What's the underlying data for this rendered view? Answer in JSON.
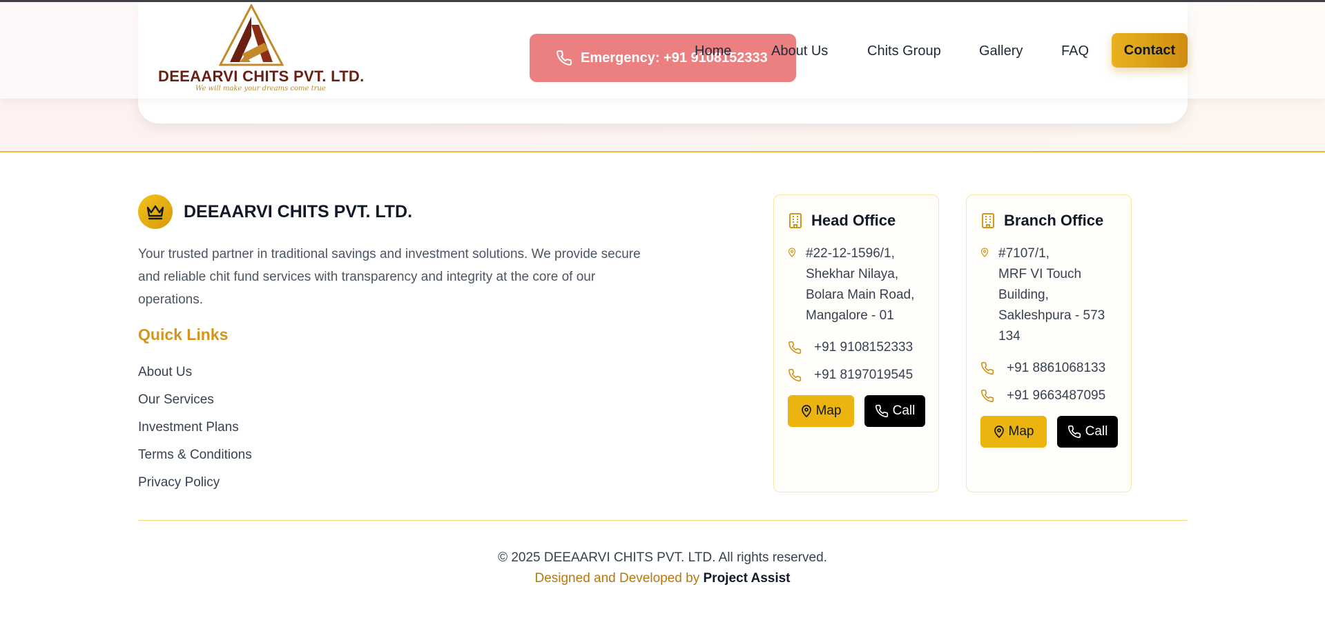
{
  "header": {
    "logo": {
      "name": "DEEAARVI CHITS PVT. LTD.",
      "tagline": "We will make your dreams come true",
      "icon": "triangle-a-logo-icon"
    },
    "emergency": {
      "label": "Emergency: +91 9108152333",
      "icon": "phone-icon",
      "color": "#ec7f7f"
    },
    "nav": [
      {
        "label": "Home"
      },
      {
        "label": "About Us"
      },
      {
        "label": "Chits Group"
      },
      {
        "label": "Gallery"
      },
      {
        "label": "FAQ"
      }
    ],
    "contact_label": "Contact"
  },
  "footer": {
    "brand": {
      "name": "DEEAARVI CHITS PVT. LTD.",
      "icon": "crown-icon"
    },
    "about": "Your trusted partner in traditional savings and investment solutions. We provide secure and reliable chit fund services with transparency and integrity at the core of our operations.",
    "quick_links": {
      "title": "Quick Links",
      "items": [
        {
          "label": "About Us"
        },
        {
          "label": "Our Services"
        },
        {
          "label": "Investment Plans"
        },
        {
          "label": "Terms & Conditions"
        },
        {
          "label": "Privacy Policy"
        }
      ]
    },
    "offices": [
      {
        "title": "Head Office",
        "address": [
          "#22-12-1596/1,",
          "Shekhar Nilaya,",
          "Bolara Main Road,",
          "Mangalore - 01"
        ],
        "phones": [
          "+91 9108152333",
          "+91 8197019545"
        ],
        "map_label": "Map",
        "call_label": "Call"
      },
      {
        "title": "Branch Office",
        "address": [
          "#7107/1,",
          "MRF VI Touch",
          "Building,",
          "Sakleshpura - 573",
          "134"
        ],
        "phones": [
          "+91 8861068133",
          "+91 9663487095"
        ],
        "map_label": "Map",
        "call_label": "Call"
      }
    ],
    "copyright": "© 2025 DEEAARVI CHITS PVT. LTD. All rights reserved.",
    "credit_prefix": "Designed and Developed by ",
    "credit_name": "Project Assist"
  },
  "colors": {
    "accent": "#ebb40e",
    "accent_text": "#d4961a",
    "brand_dark": "#6b1f12"
  }
}
